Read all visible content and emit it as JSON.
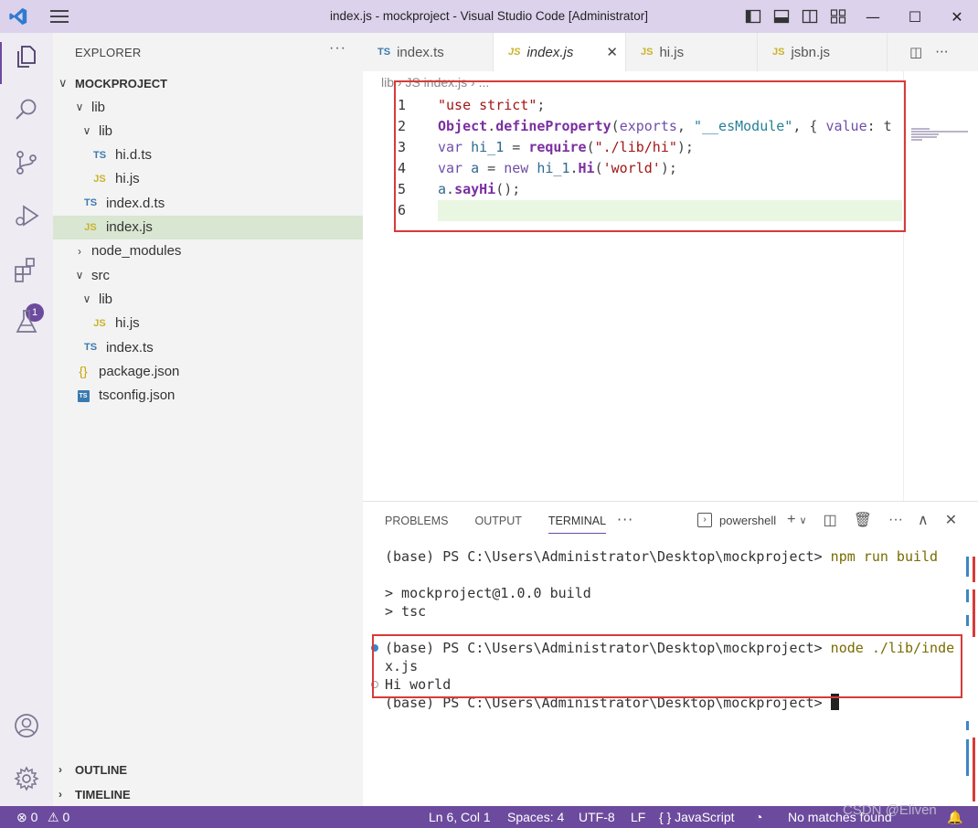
{
  "window": {
    "title": "index.js - mockproject - Visual Studio Code [Administrator]",
    "minimize": "—",
    "maximize": "☐",
    "close": "✕"
  },
  "activity_bar": {
    "items": [
      "explorer-icon",
      "search-icon",
      "source-control-icon",
      "run-debug-icon",
      "extensions-icon",
      "testing-icon"
    ],
    "extensions_badge": "1",
    "bottom": [
      "account-icon",
      "settings-gear-icon"
    ]
  },
  "sidebar": {
    "title": "EXPLORER",
    "more": "···",
    "project": "MOCKPROJECT",
    "tree": [
      {
        "label": "lib",
        "type": "folder",
        "twist": "∨",
        "icon": "",
        "depth": 1
      },
      {
        "label": "lib",
        "type": "folder",
        "twist": "∨",
        "icon": "",
        "depth": 2
      },
      {
        "label": "hi.d.ts",
        "type": "ts",
        "twist": "",
        "icon": "TS",
        "depth": 3
      },
      {
        "label": "hi.js",
        "type": "js",
        "twist": "",
        "icon": "JS",
        "depth": 3
      },
      {
        "label": "index.d.ts",
        "type": "ts",
        "twist": "",
        "icon": "TS",
        "depth": 2
      },
      {
        "label": "index.js",
        "type": "js",
        "twist": "",
        "icon": "JS",
        "depth": 2,
        "selected": true
      },
      {
        "label": "node_modules",
        "type": "folder",
        "twist": "›",
        "icon": "",
        "depth": 1
      },
      {
        "label": "src",
        "type": "folder",
        "twist": "∨",
        "icon": "",
        "depth": 1
      },
      {
        "label": "lib",
        "type": "folder",
        "twist": "∨",
        "icon": "",
        "depth": 2
      },
      {
        "label": "hi.js",
        "type": "js",
        "twist": "",
        "icon": "JS",
        "depth": 3
      },
      {
        "label": "index.ts",
        "type": "ts",
        "twist": "",
        "icon": "TS",
        "depth": 2
      },
      {
        "label": "package.json",
        "type": "json",
        "twist": "",
        "icon": "{}",
        "depth": 1
      },
      {
        "label": "tsconfig.json",
        "type": "tsconfig",
        "twist": "",
        "icon": "TS",
        "depth": 1
      }
    ],
    "outline": "OUTLINE",
    "timeline": "TIMELINE"
  },
  "editor": {
    "tabs": [
      {
        "icon": "TS",
        "label": "index.ts",
        "active": false
      },
      {
        "icon": "JS",
        "label": "index.js",
        "active": true,
        "close": "✕"
      },
      {
        "icon": "JS",
        "label": "hi.js",
        "active": false
      },
      {
        "icon": "JS",
        "label": "jsbn.js",
        "active": false
      }
    ],
    "breadcrumb": "lib  ›  JS index.js  ›  ...",
    "lines": [
      {
        "n": "1",
        "tokens": [
          [
            "str",
            "\"use strict\""
          ],
          [
            "plain",
            ";"
          ]
        ]
      },
      {
        "n": "2",
        "tokens": [
          [
            "fn",
            "Object"
          ],
          [
            "plain",
            "."
          ],
          [
            "fn",
            "defineProperty"
          ],
          [
            "plain",
            "("
          ],
          [
            "kw",
            "exports"
          ],
          [
            "plain",
            ", "
          ],
          [
            "str2",
            "\"__esModule\""
          ],
          [
            "plain",
            ", { "
          ],
          [
            "kw",
            "value"
          ],
          [
            "plain",
            ": t"
          ]
        ]
      },
      {
        "n": "3",
        "tokens": [
          [
            "kw",
            "var "
          ],
          [
            "id",
            "hi_1"
          ],
          [
            "plain",
            " = "
          ],
          [
            "fn",
            "require"
          ],
          [
            "plain",
            "("
          ],
          [
            "str",
            "\"./lib/hi\""
          ],
          [
            "plain",
            ");"
          ]
        ]
      },
      {
        "n": "4",
        "tokens": [
          [
            "kw",
            "var "
          ],
          [
            "id",
            "a"
          ],
          [
            "plain",
            " = "
          ],
          [
            "kw",
            "new "
          ],
          [
            "id",
            "hi_1"
          ],
          [
            "plain",
            "."
          ],
          [
            "fn",
            "Hi"
          ],
          [
            "plain",
            "("
          ],
          [
            "str",
            "'world'"
          ],
          [
            "plain",
            ");"
          ]
        ]
      },
      {
        "n": "5",
        "tokens": [
          [
            "id",
            "a"
          ],
          [
            "plain",
            "."
          ],
          [
            "fn",
            "sayHi"
          ],
          [
            "plain",
            "();"
          ]
        ]
      },
      {
        "n": "6",
        "tokens": []
      }
    ]
  },
  "panel": {
    "tabs": [
      "PROBLEMS",
      "OUTPUT",
      "TERMINAL"
    ],
    "active_tab": "TERMINAL",
    "more": "···",
    "shell": "powershell",
    "terminal": [
      {
        "prompt": "(base) PS C:\\Users\\Administrator\\Desktop\\mockproject> ",
        "cmd": "npm run build"
      },
      {
        "prompt": "",
        "cmd": ""
      },
      {
        "prompt": "> mockproject@1.0.0 build",
        "cmd": ""
      },
      {
        "prompt": "> tsc",
        "cmd": ""
      },
      {
        "prompt": "",
        "cmd": ""
      },
      {
        "prompt": "(base) PS C:\\Users\\Administrator\\Desktop\\mockproject> ",
        "cmd": "node ./lib/inde"
      },
      {
        "prompt": "x.js",
        "cmd": ""
      },
      {
        "prompt": "Hi world",
        "cmd": ""
      },
      {
        "prompt": "(base) PS C:\\Users\\Administrator\\Desktop\\mockproject> ",
        "cmd": ""
      }
    ]
  },
  "statusbar": {
    "errors": "⊗ 0",
    "warnings": "⚠ 0",
    "position": "Ln 6, Col 1",
    "spaces": "Spaces: 4",
    "encoding": "UTF-8",
    "eol": "LF",
    "language": "{ } JavaScript",
    "copilot": "copilot-icon",
    "matches": "No matches found",
    "notifications": "bell-icon"
  },
  "watermark": "CSDN @Eliven",
  "colors": {
    "accent": "#6c4b9e",
    "titlebar": "#dcd2ec",
    "highlight_box": "#d83a3a"
  }
}
